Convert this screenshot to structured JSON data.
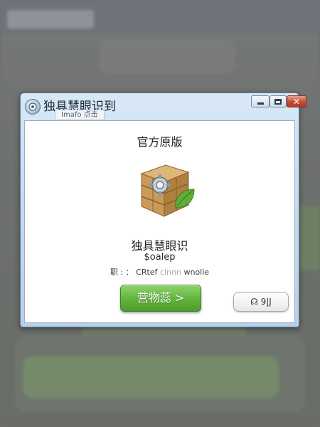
{
  "background": {
    "badge_text": "",
    "accent_green": "#7a9b6a"
  },
  "window": {
    "title": "独具慧眼识到",
    "subtitle": "Imafo 点击",
    "controls": {
      "minimize_icon": "minimize-icon",
      "maximize_icon": "maximize-icon",
      "close_glyph": "✕"
    }
  },
  "content": {
    "heading": "官方原版",
    "product_icon": "wooden-crate-with-gear-and-leaf-icon",
    "product_name": "独具慧眼识",
    "version": "$oalep",
    "meta_label": "职 : ：",
    "meta_value": "CRtef",
    "meta_faded": "cinnn",
    "meta_tail": "wnolle"
  },
  "buttons": {
    "primary_label": "营物蕊 >",
    "primary_color": "#5fb43c",
    "secondary_label": "☊ 9|J"
  },
  "colors": {
    "titlebar": "#c2d8ee",
    "close_red": "#c24a33",
    "window_border": "#5f7fa3"
  }
}
